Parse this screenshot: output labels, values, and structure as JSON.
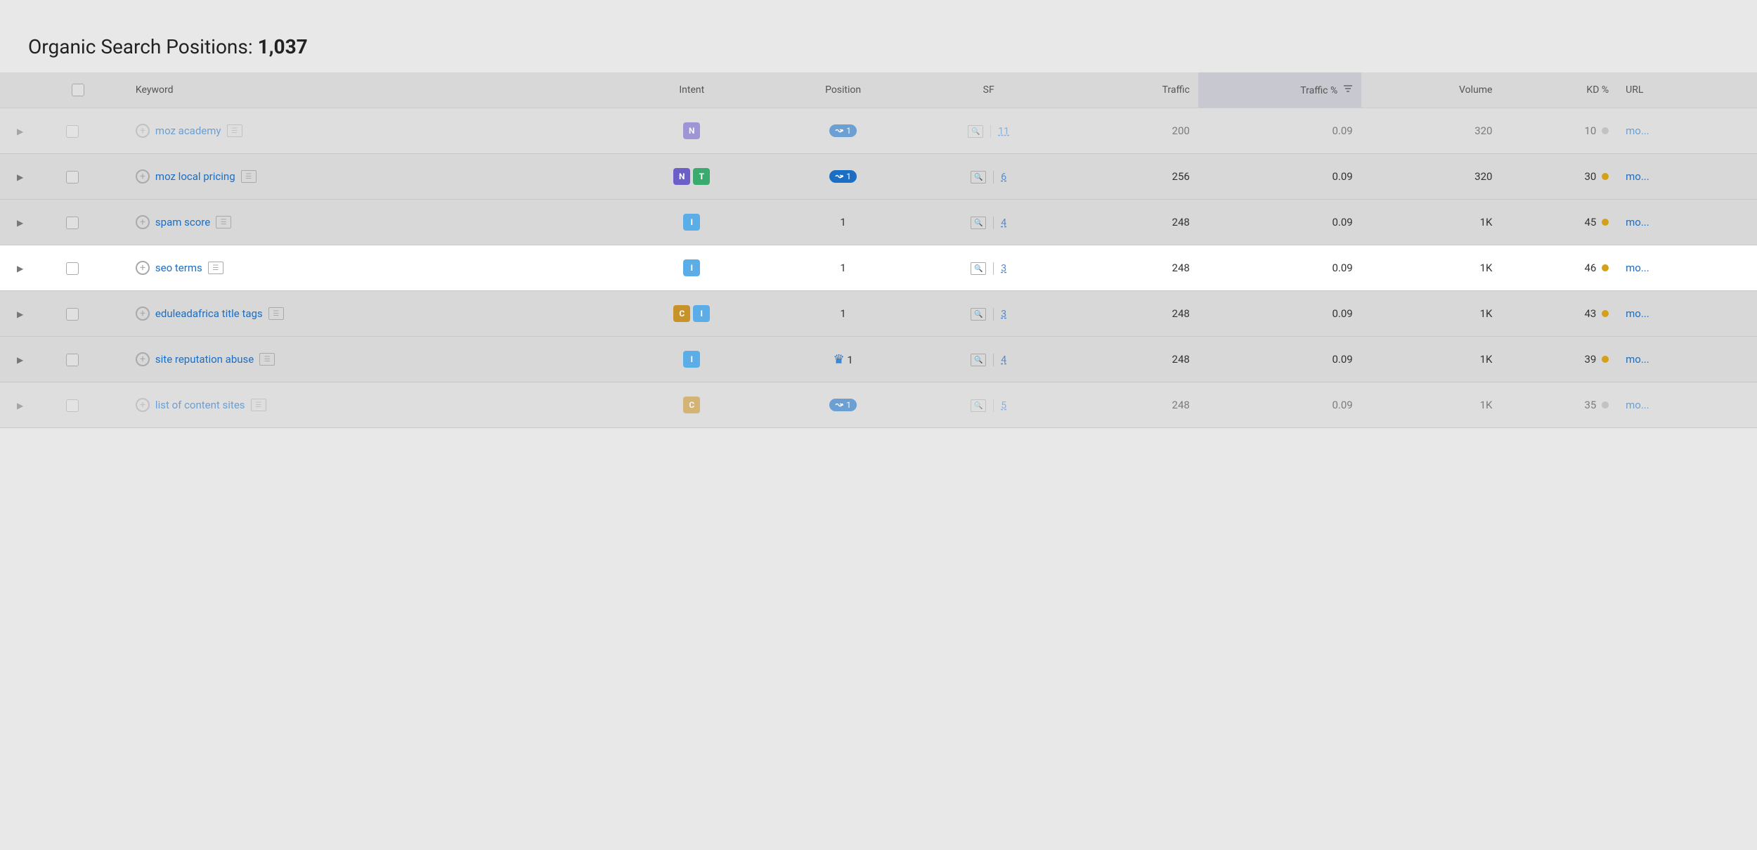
{
  "header": {
    "title": "Organic Search Positions:",
    "count": "1,037"
  },
  "columns": {
    "keyword": "Keyword",
    "intent": "Intent",
    "position": "Position",
    "sf": "SF",
    "traffic": "Traffic",
    "traffic_pct": "Traffic %",
    "volume": "Volume",
    "kd": "KD %",
    "url": "URL"
  },
  "rows": [
    {
      "id": "row-moz-academy",
      "keyword": "moz academy",
      "intents": [
        "N"
      ],
      "intent_types": [
        "intent-n"
      ],
      "position": "1",
      "position_type": "link",
      "sf": "11",
      "sf_underline": true,
      "traffic": "200",
      "traffic_pct": "0.09",
      "volume": "320",
      "kd": "10",
      "kd_color": "kd-dot-gray",
      "url": "mo...",
      "dimmed": true,
      "expanded": false
    },
    {
      "id": "row-moz-local-pricing",
      "keyword": "moz local pricing",
      "intents": [
        "N",
        "T"
      ],
      "intent_types": [
        "intent-n",
        "intent-t"
      ],
      "position": "1",
      "position_type": "link",
      "sf": "6",
      "sf_underline": true,
      "traffic": "256",
      "traffic_pct": "0.09",
      "volume": "320",
      "kd": "30",
      "kd_color": "kd-dot-yellow",
      "url": "mo...",
      "dimmed": false,
      "expanded": false
    },
    {
      "id": "row-spam-score",
      "keyword": "spam score",
      "intents": [
        "I"
      ],
      "intent_types": [
        "intent-i"
      ],
      "position": "1",
      "position_type": "normal",
      "sf": "4",
      "sf_underline": true,
      "traffic": "248",
      "traffic_pct": "0.09",
      "volume": "1K",
      "kd": "45",
      "kd_color": "kd-dot-yellow",
      "url": "mo...",
      "dimmed": false,
      "expanded": false
    },
    {
      "id": "row-seo-terms",
      "keyword": "seo terms",
      "intents": [
        "I"
      ],
      "intent_types": [
        "intent-i"
      ],
      "position": "1",
      "position_type": "normal",
      "sf": "3",
      "sf_underline": true,
      "traffic": "248",
      "traffic_pct": "0.09",
      "volume": "1K",
      "kd": "46",
      "kd_color": "kd-dot-yellow",
      "url": "mo...",
      "highlighted": true,
      "dimmed": false,
      "expanded": false
    },
    {
      "id": "row-eduleadafrica",
      "keyword": "eduleadafrica title tags",
      "intents": [
        "C",
        "I"
      ],
      "intent_types": [
        "intent-c",
        "intent-i"
      ],
      "position": "1",
      "position_type": "normal",
      "sf": "3",
      "sf_underline": true,
      "traffic": "248",
      "traffic_pct": "0.09",
      "volume": "1K",
      "kd": "43",
      "kd_color": "kd-dot-yellow",
      "url": "mo...",
      "dimmed": false,
      "expanded": false
    },
    {
      "id": "row-site-reputation",
      "keyword": "site reputation abuse",
      "intents": [
        "I"
      ],
      "intent_types": [
        "intent-i"
      ],
      "position": "1",
      "position_type": "crown",
      "sf": "4",
      "sf_underline": true,
      "traffic": "248",
      "traffic_pct": "0.09",
      "volume": "1K",
      "kd": "39",
      "kd_color": "kd-dot-yellow",
      "url": "mo...",
      "dimmed": false,
      "expanded": false
    },
    {
      "id": "row-list-of-content-sites",
      "keyword": "list of content sites",
      "intents": [
        "C"
      ],
      "intent_types": [
        "intent-c"
      ],
      "position": "1",
      "position_type": "link",
      "sf": "5",
      "sf_underline": true,
      "traffic": "248",
      "traffic_pct": "0.09",
      "volume": "1K",
      "kd": "35",
      "kd_color": "kd-dot-gray",
      "url": "mo...",
      "dimmed": true,
      "expanded": false
    }
  ]
}
